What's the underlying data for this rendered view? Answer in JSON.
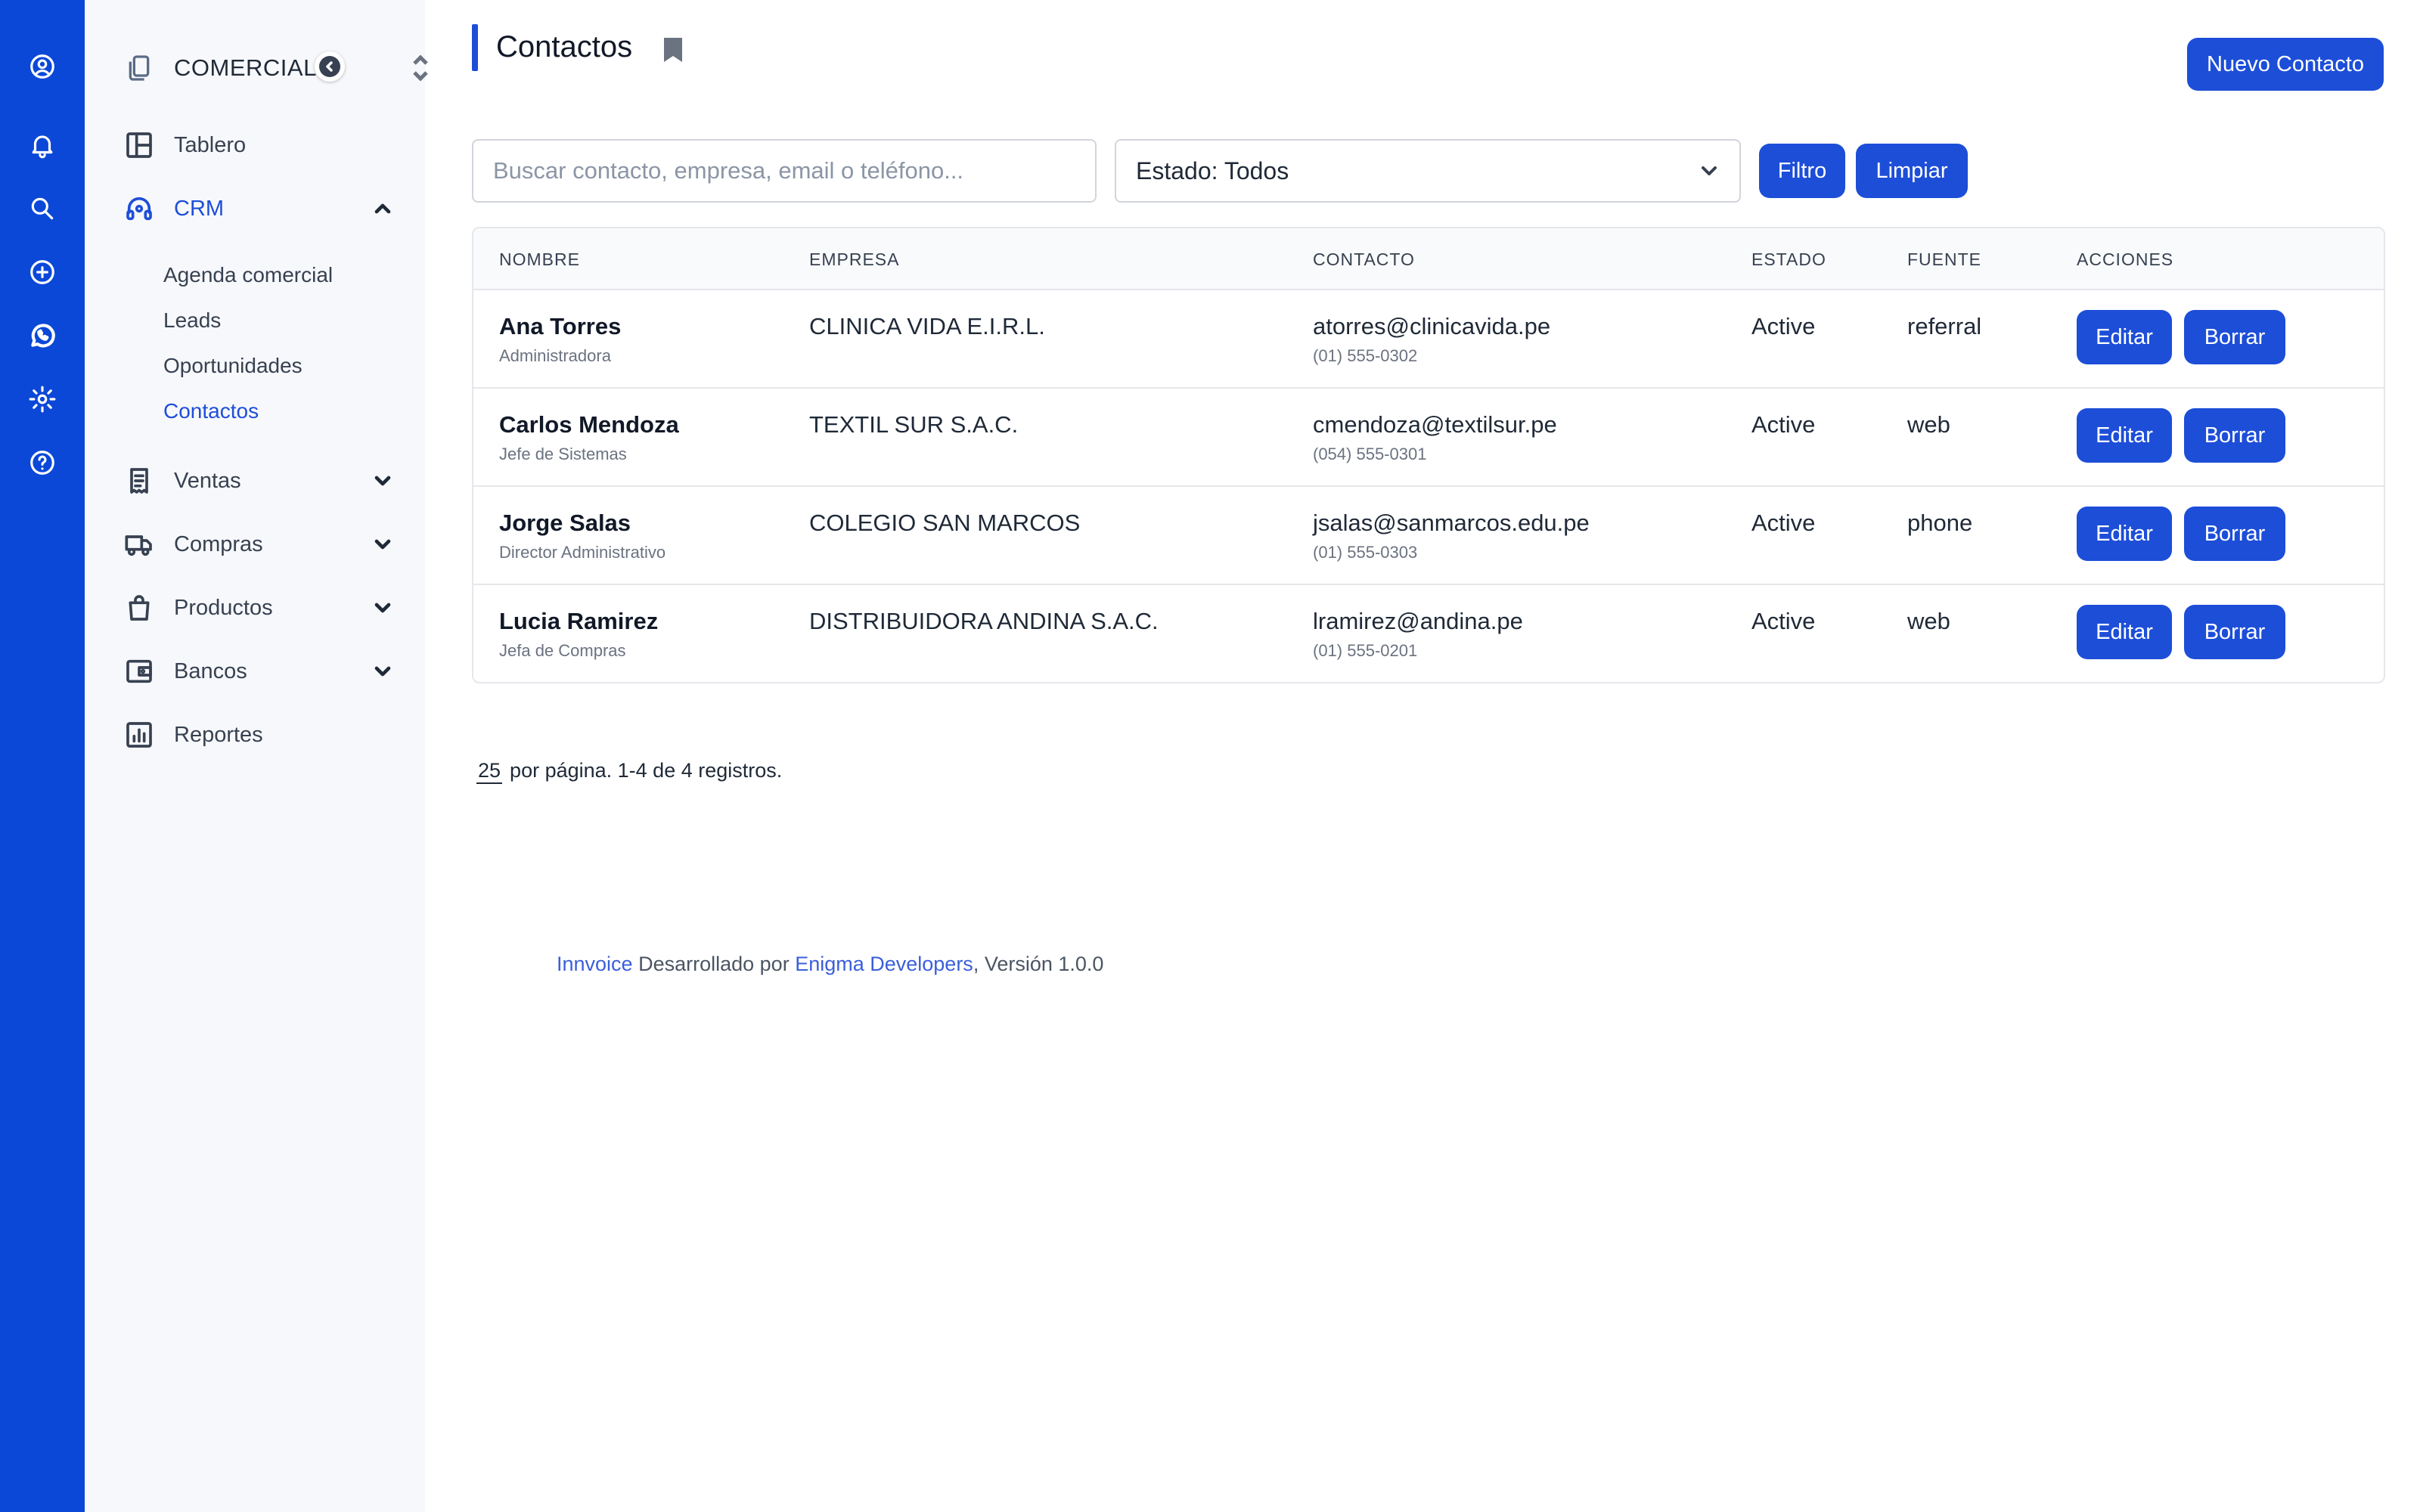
{
  "rail": {
    "icons": [
      "user-circle-icon",
      "bell-icon",
      "search-icon",
      "plus-circle-icon",
      "whatsapp-icon",
      "gear-icon",
      "help-circle-icon"
    ]
  },
  "sidebar": {
    "company": "COMERCIAL ...",
    "items": [
      {
        "label": "Tablero",
        "icon": "layout-icon"
      },
      {
        "label": "CRM",
        "icon": "headset-icon"
      },
      {
        "label": "Ventas",
        "icon": "receipt-icon"
      },
      {
        "label": "Compras",
        "icon": "truck-icon"
      },
      {
        "label": "Productos",
        "icon": "shopping-bag-icon"
      },
      {
        "label": "Bancos",
        "icon": "wallet-icon"
      },
      {
        "label": "Reportes",
        "icon": "chart-icon"
      }
    ],
    "crm_sub": [
      "Agenda comercial",
      "Leads",
      "Oportunidades",
      "Contactos"
    ]
  },
  "main": {
    "title": "Contactos",
    "new_button": "Nuevo Contacto",
    "search_placeholder": "Buscar contacto, empresa, email o teléfono...",
    "status_filter": "Estado: Todos",
    "filter_button": "Filtro",
    "clear_button": "Limpiar"
  },
  "table": {
    "headers": [
      "NOMBRE",
      "EMPRESA",
      "CONTACTO",
      "ESTADO",
      "FUENTE",
      "ACCIONES"
    ],
    "rows": [
      {
        "name": "Ana Torres",
        "role": "Administradora",
        "company": "CLINICA VIDA E.I.R.L.",
        "email": "atorres@clinicavida.pe",
        "phone": "(01) 555-0302",
        "status": "Active",
        "source": "referral"
      },
      {
        "name": "Carlos Mendoza",
        "role": "Jefe de Sistemas",
        "company": "TEXTIL SUR S.A.C.",
        "email": "cmendoza@textilsur.pe",
        "phone": "(054) 555-0301",
        "status": "Active",
        "source": "web"
      },
      {
        "name": "Jorge Salas",
        "role": "Director Administrativo",
        "company": "COLEGIO SAN MARCOS",
        "email": "jsalas@sanmarcos.edu.pe",
        "phone": "(01) 555-0303",
        "status": "Active",
        "source": "phone"
      },
      {
        "name": "Lucia Ramirez",
        "role": "Jefa de Compras",
        "company": "DISTRIBUIDORA ANDINA S.A.C.",
        "email": "lramirez@andina.pe",
        "phone": "(01) 555-0201",
        "status": "Active",
        "source": "web"
      }
    ],
    "edit_label": "Editar",
    "delete_label": "Borrar"
  },
  "pagination": {
    "per_page": "25",
    "summary": "por página. 1-4 de 4 registros."
  },
  "footer": {
    "app": "Innvoice",
    "middle": " Desarrollado por ",
    "dev": "Enigma Developers",
    "version": ", Versión 1.0.0"
  },
  "colors": {
    "accent": "#1d4ed8",
    "rail": "#0b48d8"
  }
}
